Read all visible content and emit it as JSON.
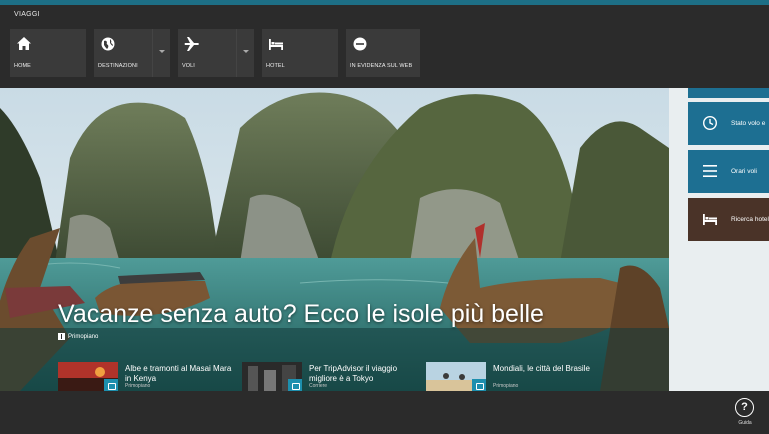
{
  "app": {
    "title": "VIAGGI"
  },
  "nav": [
    {
      "label": "HOME",
      "icon": "home-icon"
    },
    {
      "label": "DESTINAZIONI",
      "icon": "globe-icon"
    },
    {
      "label": "VOLI",
      "icon": "airplane-icon"
    },
    {
      "label": "HOTEL",
      "icon": "bed-icon"
    },
    {
      "label": "IN EVIDENZA SUL WEB",
      "icon": "featured-icon"
    }
  ],
  "hero": {
    "headline": "Vacanze senza auto? Ecco le isole più belle",
    "tag": "Primopiano"
  },
  "stories": [
    {
      "title": "Albe e tramonti al Masai Mara in Kenya",
      "source": "Primopiano",
      "icon": "camera-icon"
    },
    {
      "title": "Per TripAdvisor il viaggio migliore è a Tokyo",
      "source": "Corriere",
      "icon": "camera-icon"
    },
    {
      "title": "Mondiali, le città del Brasile",
      "source": "Primopiano",
      "icon": "camera-icon"
    }
  ],
  "right_panel": [
    {
      "label": "Stato volo e",
      "icon": "clock-icon",
      "color": "#1d6f92"
    },
    {
      "label": "Orari voli",
      "icon": "list-icon",
      "color": "#1d6f92"
    },
    {
      "label": "Ricerca hotel",
      "icon": "bed-icon",
      "color": "#4a3328"
    }
  ],
  "bottom": {
    "help_label": "Guida",
    "help_icon": "question-icon"
  },
  "colors": {
    "accent": "#1d6f86",
    "background": "#2b2b2b",
    "tile": "#3a3a3a"
  }
}
